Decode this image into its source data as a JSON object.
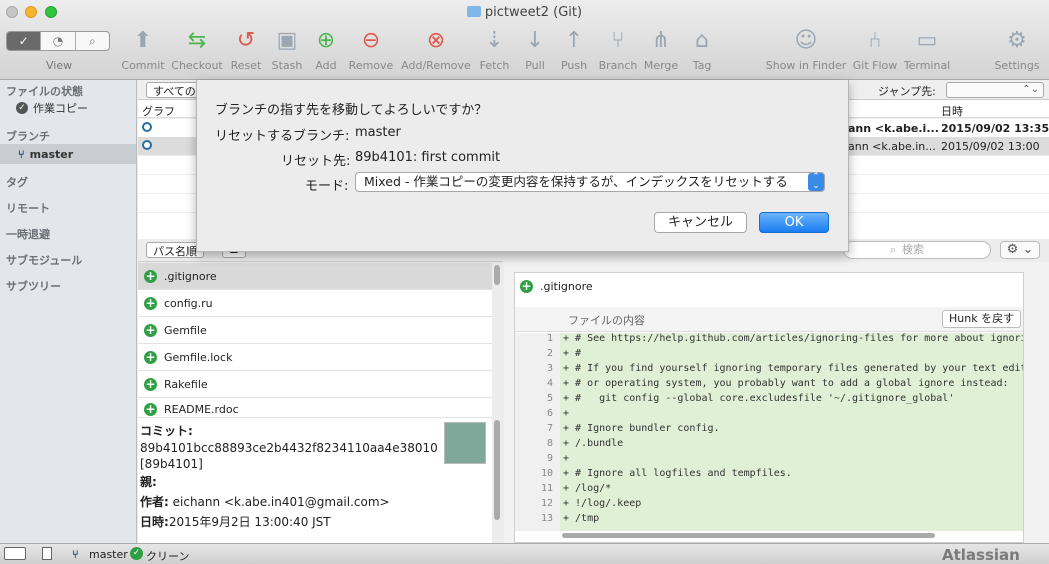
{
  "window": {
    "title": "pictweet2 (Git)"
  },
  "toolbar": {
    "view_label": "View",
    "buttons": [
      {
        "label": "Commit",
        "icon": "commit-icon"
      },
      {
        "label": "Checkout",
        "icon": "checkout-icon"
      },
      {
        "label": "Reset",
        "icon": "reset-icon"
      },
      {
        "label": "Stash",
        "icon": "stash-icon"
      },
      {
        "label": "Add",
        "icon": "add-icon"
      },
      {
        "label": "Remove",
        "icon": "remove-icon"
      },
      {
        "label": "Add/Remove",
        "icon": "add-remove-icon"
      },
      {
        "label": "Fetch",
        "icon": "fetch-icon"
      },
      {
        "label": "Pull",
        "icon": "pull-icon"
      },
      {
        "label": "Push",
        "icon": "push-icon"
      },
      {
        "label": "Branch",
        "icon": "branch-icon"
      },
      {
        "label": "Merge",
        "icon": "merge-icon"
      },
      {
        "label": "Tag",
        "icon": "tag-icon"
      },
      {
        "label": "Show in Finder",
        "icon": "finder-icon"
      },
      {
        "label": "Git Flow",
        "icon": "git-flow-icon"
      },
      {
        "label": "Terminal",
        "icon": "terminal-icon"
      },
      {
        "label": "Settings",
        "icon": "gear-icon"
      }
    ]
  },
  "sidebar": {
    "file_status_heading": "ファイルの状態",
    "working_copy": "作業コピー",
    "branch_heading": "ブランチ",
    "branch_master": "master",
    "tag_heading": "タグ",
    "remote_heading": "リモート",
    "stash_heading": "一時退避",
    "submodule_heading": "サブモジュール",
    "subtree_heading": "サブツリー"
  },
  "commit_list": {
    "filter_label": "すべての",
    "jump_label": "ジャンプ先:",
    "col_graph": "グラフ",
    "col_date": "日時",
    "rows": [
      {
        "author": "ann <k.abe.i...",
        "date": "2015/09/02 13:35"
      },
      {
        "author": "ann <k.abe.in...",
        "date": "2015/09/02 13:00"
      }
    ]
  },
  "dialog": {
    "question": "ブランチの指す先を移動してよろしいですか？",
    "branch_label": "リセットするブランチ:",
    "branch_value": "master",
    "target_label": "リセット先:",
    "target_value": "89b4101: first commit",
    "mode_label": "モード:",
    "mode_value": "Mixed - 作業コピーの変更内容を保持するが、インデックスをリセットする",
    "cancel_label": "キャンセル",
    "ok_label": "OK"
  },
  "files": {
    "sort_label": "パス名順",
    "items": [
      ".gitignore",
      "config.ru",
      "Gemfile",
      "Gemfile.lock",
      "Rakefile",
      "README.rdoc"
    ]
  },
  "details": {
    "commit_label": "コミット:",
    "hash": "89b4101bcc88893ce2b4432f8234110aa4e38010",
    "short_hash": "[89b4101]",
    "parent_label": "親:",
    "author_label": "作者:",
    "author_value": "eichann <k.abe.in401@gmail.com>",
    "date_label": "日時:",
    "date_value": "2015年9月2日 13:00:40 JST"
  },
  "diff": {
    "search_placeholder": "検索",
    "file_name": ".gitignore",
    "hunk_label": "ファイルの内容",
    "revert_hunk": "Hunk を戻す",
    "lines": [
      {
        "n": "1",
        "t": "+ # See https://help.github.com/articles/ignoring-files for more about ignori"
      },
      {
        "n": "2",
        "t": "+ #"
      },
      {
        "n": "3",
        "t": "+ # If you find yourself ignoring temporary files generated by your text edit"
      },
      {
        "n": "4",
        "t": "+ # or operating system, you probably want to add a global ignore instead:"
      },
      {
        "n": "5",
        "t": "+ #   git config --global core.excludesfile '~/.gitignore_global'"
      },
      {
        "n": "6",
        "t": "+"
      },
      {
        "n": "7",
        "t": "+ # Ignore bundler config."
      },
      {
        "n": "8",
        "t": "+ /.bundle"
      },
      {
        "n": "9",
        "t": "+"
      },
      {
        "n": "10",
        "t": "+ # Ignore all logfiles and tempfiles."
      },
      {
        "n": "11",
        "t": "+ /log/*"
      },
      {
        "n": "12",
        "t": "+ !/log/.keep"
      },
      {
        "n": "13",
        "t": "+ /tmp"
      }
    ]
  },
  "status": {
    "branch": "master",
    "state": "クリーン",
    "brand": "Atlassian"
  }
}
